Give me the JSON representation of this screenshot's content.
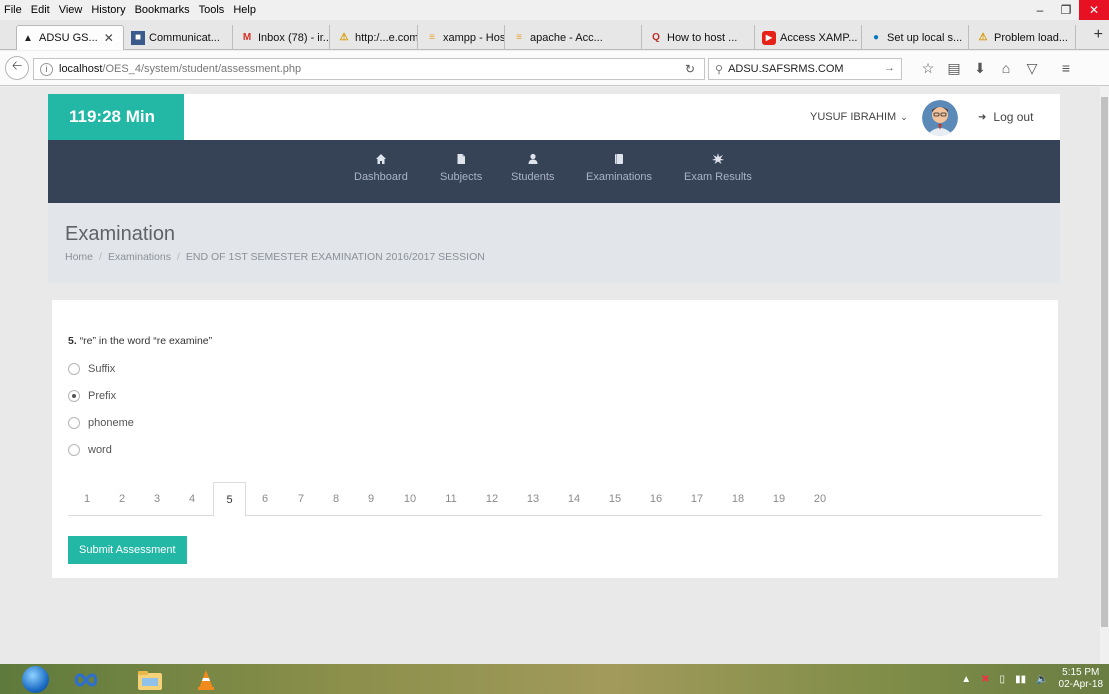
{
  "browser": {
    "menu": [
      "File",
      "Edit",
      "View",
      "History",
      "Bookmarks",
      "Tools",
      "Help"
    ],
    "tabs": [
      {
        "label": "ADSU GS...",
        "icon": "cap-icon"
      },
      {
        "label": "Communicat...",
        "icon": "page-icon"
      },
      {
        "label": "Inbox (78) - ir...",
        "icon": "gmail-icon"
      },
      {
        "label": "http:/...e.com/",
        "icon": "warning-icon"
      },
      {
        "label": "xampp - Host...",
        "icon": "stack-icon"
      },
      {
        "label": "apache - Acc...",
        "icon": "stack-icon"
      },
      {
        "label": "How to host ...",
        "icon": "quora-icon"
      },
      {
        "label": "Access XAMP...",
        "icon": "youtube-icon"
      },
      {
        "label": "Set up local s...",
        "icon": "drupal-icon"
      },
      {
        "label": "Problem load...",
        "icon": "warning-icon"
      }
    ],
    "url_host": "localhost",
    "url_path": "/OES_4/system/student/assessment.php",
    "search_value": "ADSU.SAFSRMS.COM"
  },
  "header": {
    "timer": "119:28 Min",
    "user_name": "YUSUF IBRAHIM",
    "logout_label": "Log out"
  },
  "nav": {
    "items": [
      {
        "label": "Dashboard",
        "icon": "home-icon"
      },
      {
        "label": "Subjects",
        "icon": "file-icon"
      },
      {
        "label": "Students",
        "icon": "user-icon"
      },
      {
        "label": "Examinations",
        "icon": "book-icon"
      },
      {
        "label": "Exam Results",
        "icon": "burst-icon"
      }
    ]
  },
  "page": {
    "title": "Examination",
    "breadcrumbs": [
      "Home",
      "Examinations",
      "END OF 1ST SEMESTER EXAMINATION 2016/2017 SESSION"
    ]
  },
  "question": {
    "number": "5.",
    "text": "“re” in the word “re examine”",
    "options": [
      "Suffix",
      "Prefix",
      "phoneme",
      "word"
    ],
    "selected_index": 1
  },
  "pagination": {
    "pages": [
      "1",
      "2",
      "3",
      "4",
      "5",
      "6",
      "7",
      "8",
      "9",
      "10",
      "11",
      "12",
      "13",
      "14",
      "15",
      "16",
      "17",
      "18",
      "19",
      "20"
    ],
    "active": "5"
  },
  "submit_label": "Submit Assessment",
  "taskbar": {
    "time": "5:15 PM",
    "date": "02-Apr-18"
  },
  "colors": {
    "accent": "#23b7a5",
    "nav_bg": "#364256",
    "title_bg": "#e2e6ea"
  }
}
